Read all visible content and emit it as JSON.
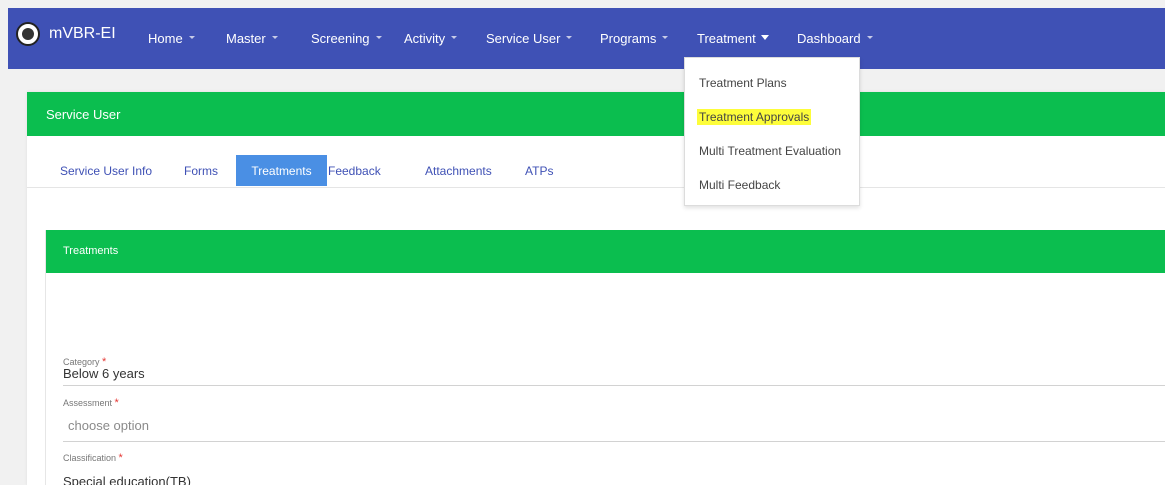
{
  "navbar": {
    "brand": "mVBR-EI",
    "items": [
      {
        "label": "Home"
      },
      {
        "label": "Master"
      },
      {
        "label": "Screening"
      },
      {
        "label": "Activity"
      },
      {
        "label": "Service User"
      },
      {
        "label": "Programs"
      },
      {
        "label": "Treatment"
      },
      {
        "label": "Dashboard"
      }
    ]
  },
  "treatment_menu": {
    "items": [
      {
        "label": "Treatment Plans"
      },
      {
        "label": "Treatment Approvals"
      },
      {
        "label": "Multi Treatment Evaluation"
      },
      {
        "label": "Multi Feedback"
      }
    ]
  },
  "service_user": {
    "title": "Service User",
    "tabs": [
      {
        "label": "Service User Info"
      },
      {
        "label": "Forms"
      },
      {
        "label": "Treatments"
      },
      {
        "label": "Feedback"
      },
      {
        "label": "Attachments"
      },
      {
        "label": "ATPs"
      }
    ],
    "active_tab": "Treatments"
  },
  "treatments": {
    "title": "Treatments",
    "required_marker": "*",
    "fields": {
      "category": {
        "label": "Category",
        "value": "Below 6 years"
      },
      "assessment": {
        "label": "Assessment",
        "placeholder": "choose option"
      },
      "classification": {
        "label": "Classification",
        "value": "Special education(TB)"
      }
    }
  },
  "colors": {
    "navbar": "#3f51b5",
    "header_green": "#0bbe4f",
    "active_tab": "#4a8fe4",
    "highlight": "#fdfd3a",
    "required": "#e53935"
  },
  "icons": {
    "brand_logo": "emblem-logo-icon",
    "menu_caret": "caret-down-icon"
  }
}
